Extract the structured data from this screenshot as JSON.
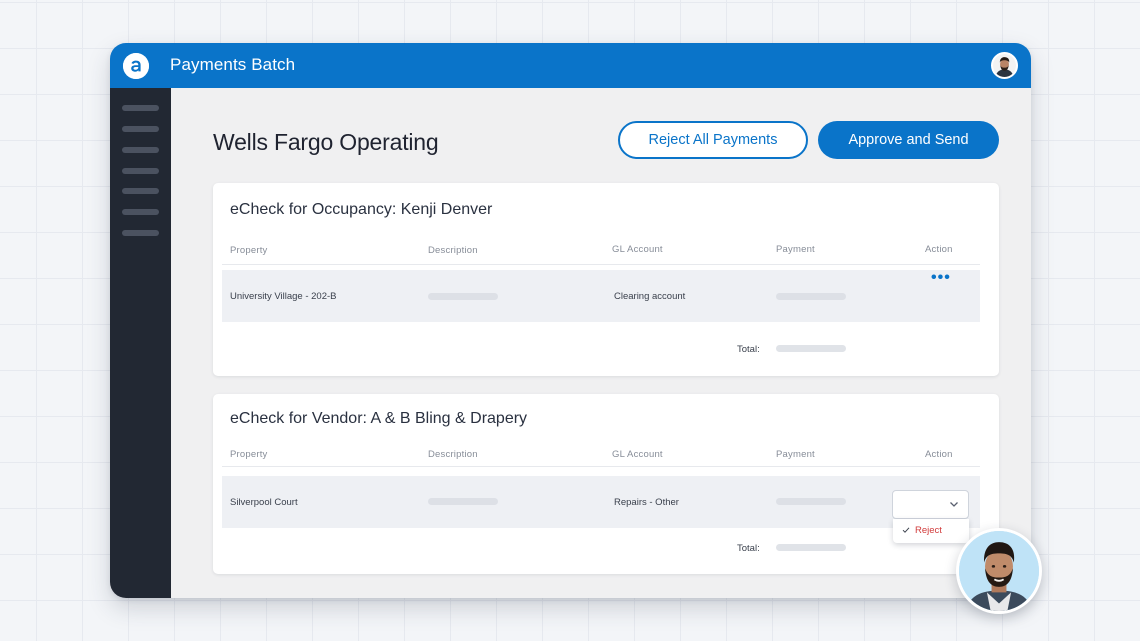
{
  "app": {
    "title": "Payments Batch",
    "brand_color": "#0a74c9",
    "logo_icon": "brand-a-logo-icon"
  },
  "page": {
    "title": "Wells Fargo Operating",
    "reject_all_label": "Reject All Payments",
    "approve_label": "Approve and Send"
  },
  "columns": {
    "property": "Property",
    "description": "Description",
    "gl_account": "GL Account",
    "payment": "Payment",
    "action": "Action"
  },
  "cards": [
    {
      "title": "eCheck for Occupancy: Kenji Denver",
      "rows": [
        {
          "property": "University Village - 202-B",
          "gl_account": "Clearing account",
          "action_icon": "more-dots-icon"
        }
      ],
      "total_label": "Total:"
    },
    {
      "title": "eCheck for Vendor: A & B Bling & Drapery",
      "rows": [
        {
          "property": "Silverpool Court",
          "gl_account": "Repairs - Other",
          "action_icon": "chevron-down-icon"
        }
      ],
      "total_label": "Total:",
      "action_dropdown": {
        "selected_option": "Reject",
        "option_color": "#d13b3b"
      }
    }
  ]
}
